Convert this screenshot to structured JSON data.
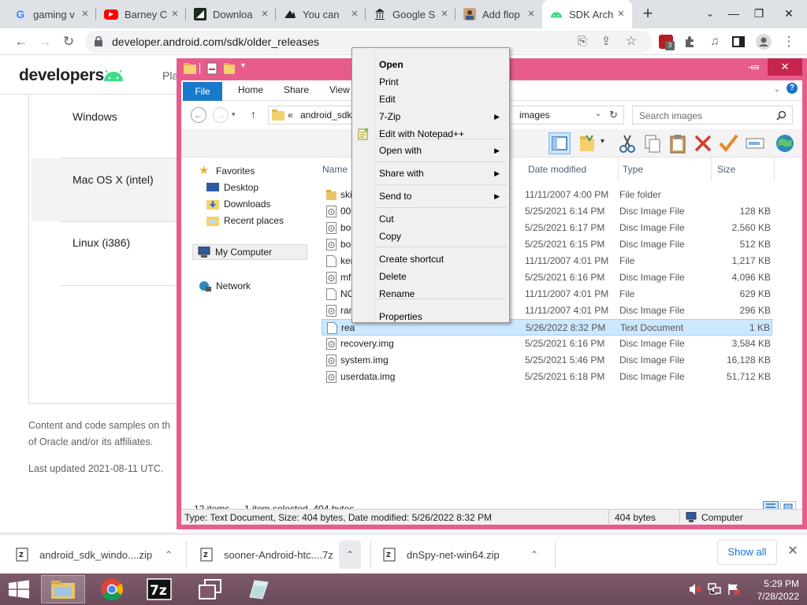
{
  "browser": {
    "tabs": [
      {
        "title": "gaming v",
        "favicon": "G",
        "color": "#4285f4"
      },
      {
        "title": "Barney C",
        "favicon": "▶",
        "color": "#ff0000"
      },
      {
        "title": "Downloa",
        "favicon": "",
        "color": "#1a1a1a"
      },
      {
        "title": "You can",
        "favicon": "",
        "color": "#1a1a1a"
      },
      {
        "title": "Google S",
        "favicon": "",
        "color": "#1a1a1a"
      },
      {
        "title": "Add flop",
        "favicon": "",
        "color": "#8a5a3c"
      },
      {
        "title": "SDK Arch",
        "favicon": "",
        "color": "#3ddc84",
        "active": true
      }
    ],
    "url": "developer.android.com/sdk/older_releases",
    "extension_badge": "3"
  },
  "page": {
    "logo_text": "developers",
    "nav_partial": "Pla",
    "platforms": [
      "Windows",
      "Mac OS X (intel)",
      "Linux (i386)"
    ],
    "footer_line1": "Content and code samples on th",
    "footer_line2": "of Oracle and/or its affiliates.",
    "last_updated": "Last updated 2021-08-11 UTC."
  },
  "downloads": {
    "items": [
      "android_sdk_windo....zip",
      "sooner-Android-htc....7z",
      "dnSpy-net-win64.zip"
    ],
    "show_all": "Show all"
  },
  "explorer": {
    "ribbon_tabs": [
      "File",
      "Home",
      "Share",
      "View"
    ],
    "address": {
      "prefix": "«",
      "left": "android_sdk_",
      "right": "images"
    },
    "search_placeholder": "Search images",
    "nav": {
      "favorites": "Favorites",
      "desktop": "Desktop",
      "downloads": "Downloads",
      "recent": "Recent places",
      "computer": "My Computer",
      "network": "Network"
    },
    "columns": {
      "name": "Name",
      "date": "Date modified",
      "type": "Type",
      "size": "Size"
    },
    "files": [
      {
        "name": "skii",
        "date": "11/11/2007 4:00 PM",
        "type": "File folder",
        "size": "",
        "icon": "folder"
      },
      {
        "name": "000",
        "date": "5/25/2021 6:14 PM",
        "type": "Disc Image File",
        "size": "128 KB",
        "icon": "disc"
      },
      {
        "name": "boo",
        "date": "5/25/2021 6:17 PM",
        "type": "Disc Image File",
        "size": "2,560 KB",
        "icon": "disc"
      },
      {
        "name": "boo",
        "date": "5/25/2021 6:15 PM",
        "type": "Disc Image File",
        "size": "512 KB",
        "icon": "disc"
      },
      {
        "name": "ker",
        "date": "11/11/2007 4:01 PM",
        "type": "File",
        "size": "1,217 KB",
        "icon": "file"
      },
      {
        "name": "mf",
        "date": "5/25/2021 6:16 PM",
        "type": "Disc Image File",
        "size": "4,096 KB",
        "icon": "disc"
      },
      {
        "name": "NO",
        "date": "11/11/2007 4:01 PM",
        "type": "File",
        "size": "629 KB",
        "icon": "file"
      },
      {
        "name": "ran",
        "date": "11/11/2007 4:01 PM",
        "type": "Disc Image File",
        "size": "296 KB",
        "icon": "disc"
      },
      {
        "name": "rea",
        "date": "5/26/2022 8:32 PM",
        "type": "Text Document",
        "size": "1 KB",
        "icon": "file",
        "selected": true
      },
      {
        "name": "recovery.img",
        "date": "5/25/2021 6:16 PM",
        "type": "Disc Image File",
        "size": "3,584 KB",
        "icon": "disc"
      },
      {
        "name": "system.img",
        "date": "5/25/2021 5:46 PM",
        "type": "Disc Image File",
        "size": "16,128 KB",
        "icon": "disc"
      },
      {
        "name": "userdata.img",
        "date": "5/25/2021 6:18 PM",
        "type": "Disc Image File",
        "size": "51,712 KB",
        "icon": "disc"
      }
    ],
    "status": {
      "items": "12 items",
      "selected": "1 item selected  404 bytes"
    },
    "details_bar": {
      "text": "Type: Text Document, Size: 404 bytes, Date modified: 5/26/2022 8:32 PM",
      "size": "404 bytes",
      "location": "Computer"
    }
  },
  "context_menu": {
    "items": [
      {
        "label": "Open",
        "bold": true
      },
      {
        "label": "Print"
      },
      {
        "label": "Edit"
      },
      {
        "label": "7-Zip",
        "submenu": true
      },
      {
        "label": "Edit with Notepad++",
        "icon": "notepad"
      },
      {
        "label": "Open with",
        "submenu": true
      },
      {
        "label": "Share with",
        "submenu": true
      },
      {
        "label": "Send to",
        "submenu": true
      },
      {
        "label": "Cut"
      },
      {
        "label": "Copy"
      },
      {
        "label": "Create shortcut"
      },
      {
        "label": "Delete"
      },
      {
        "label": "Rename"
      },
      {
        "label": "Properties"
      }
    ]
  },
  "taskbar": {
    "time": "5:29 PM",
    "date": "7/28/2022"
  }
}
